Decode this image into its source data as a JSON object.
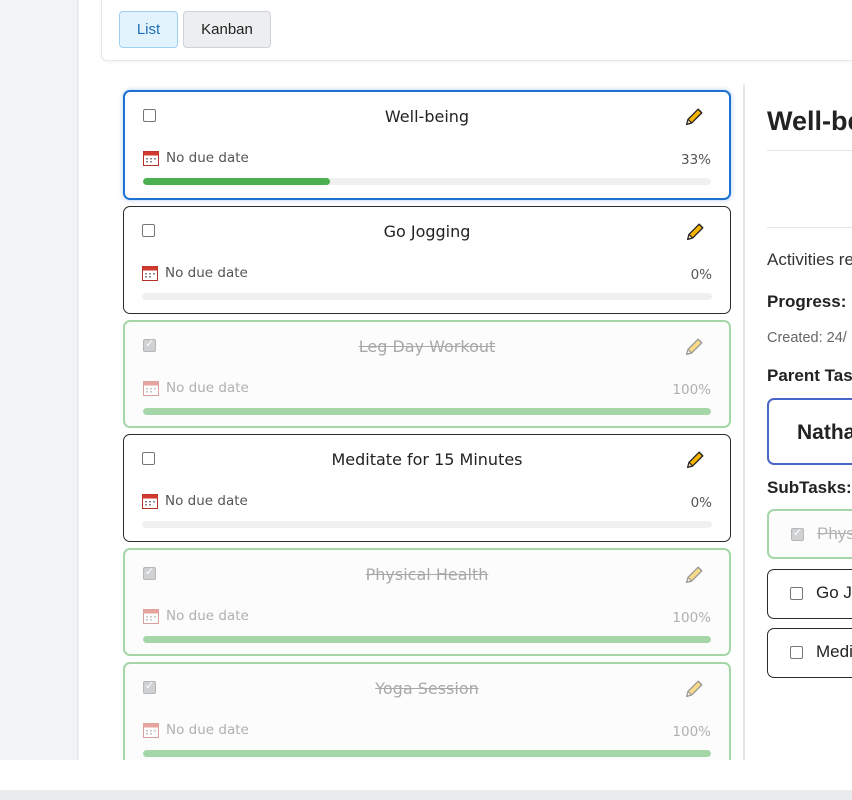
{
  "toolbar": {
    "views": [
      {
        "label": "List",
        "active": true
      },
      {
        "label": "Kanban",
        "active": false
      }
    ]
  },
  "tasks": [
    {
      "title": "Well-being",
      "due": "No due date",
      "progress": "33%",
      "progress_value": 33,
      "completed": false,
      "selected": true
    },
    {
      "title": "Go Jogging",
      "due": "No due date",
      "progress": "0%",
      "progress_value": 0,
      "completed": false,
      "selected": false
    },
    {
      "title": "Leg Day Workout",
      "due": "No due date",
      "progress": "100%",
      "progress_value": 100,
      "completed": true,
      "selected": false
    },
    {
      "title": "Meditate for 15 Minutes",
      "due": "No due date",
      "progress": "0%",
      "progress_value": 0,
      "completed": false,
      "selected": false
    },
    {
      "title": "Physical Health",
      "due": "No due date",
      "progress": "100%",
      "progress_value": 100,
      "completed": true,
      "selected": false
    },
    {
      "title": "Yoga Session",
      "due": "No due date",
      "progress": "100%",
      "progress_value": 100,
      "completed": true,
      "selected": false
    }
  ],
  "detail": {
    "title": "Well-be",
    "description": "Activities re",
    "progress_label": "Progress:",
    "created": "Created: 24/",
    "parent_label": "Parent Tas",
    "parent_name": "Natha",
    "subtasks_label": "SubTasks:",
    "subtasks": [
      {
        "label": "Phys",
        "completed": true
      },
      {
        "label": "Go J",
        "completed": false
      },
      {
        "label": "Medi",
        "completed": false
      }
    ]
  },
  "colors": {
    "accent": "#1c71d2",
    "progress_fill": "#4caf50",
    "done_border": "#a5d6a7",
    "parent_border": "#4a66c9"
  },
  "icons": {
    "edit": "pencil-icon",
    "due": "calendar-icon"
  }
}
